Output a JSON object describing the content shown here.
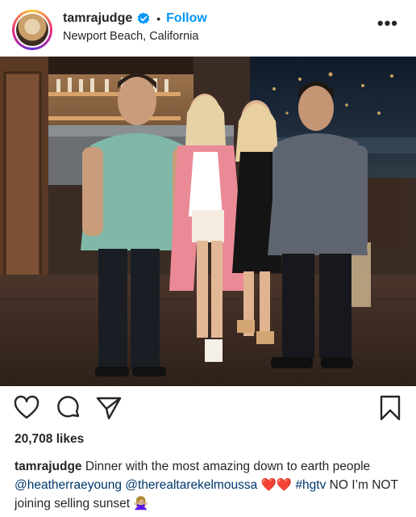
{
  "post": {
    "username": "tamrajudge",
    "verified": true,
    "separator": "•",
    "follow_label": "Follow",
    "location": "Newport Beach, California",
    "more_label": "•••"
  },
  "actions": {
    "like_icon": "heart-icon",
    "comment_icon": "comment-icon",
    "share_icon": "paper-plane-icon",
    "save_icon": "bookmark-icon"
  },
  "likes": "20,708 likes",
  "caption": {
    "username": "tamrajudge",
    "text_1": "Dinner with the most amazing down to earth people",
    "mention_1": "@heatherraeyoung",
    "mention_2": "@therealtarekelmoussa",
    "emoji_1": "❤️❤️",
    "hashtag": "#hgtv",
    "text_2": "NO I’m NOT joining selling sunset",
    "emoji_2": "🙅🏼‍♀️"
  },
  "colors": {
    "accent": "#0095f6",
    "tag": "#00376b",
    "text": "#262626"
  }
}
